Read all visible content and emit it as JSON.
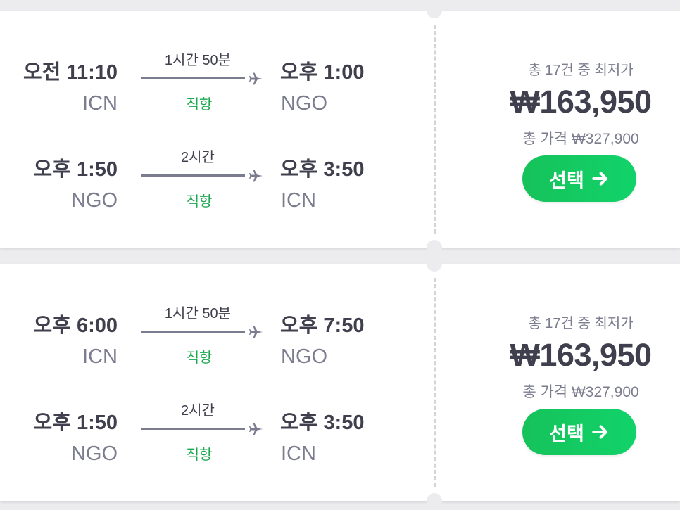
{
  "results": [
    {
      "legs": [
        {
          "departure_time": "오전 11:10",
          "departure_code": "ICN",
          "duration": "1시간 50분",
          "stops": "직항",
          "arrival_time": "오후 1:00",
          "arrival_code": "NGO"
        },
        {
          "departure_time": "오후 1:50",
          "departure_code": "NGO",
          "duration": "2시간",
          "stops": "직항",
          "arrival_time": "오후 3:50",
          "arrival_code": "ICN"
        }
      ],
      "price_caption": "총 17건 중 최저가",
      "price": "₩163,950",
      "total_price": "총 가격 ₩327,900",
      "select_label": "선택"
    },
    {
      "legs": [
        {
          "departure_time": "오후 6:00",
          "departure_code": "ICN",
          "duration": "1시간 50분",
          "stops": "직항",
          "arrival_time": "오후 7:50",
          "arrival_code": "NGO"
        },
        {
          "departure_time": "오후 1:50",
          "departure_code": "NGO",
          "duration": "2시간",
          "stops": "직항",
          "arrival_time": "오후 3:50",
          "arrival_code": "ICN"
        }
      ],
      "price_caption": "총 17건 중 최저가",
      "price": "₩163,950",
      "total_price": "총 가격 ₩327,900",
      "select_label": "선택"
    }
  ],
  "colors": {
    "text_dark": "#3f3f4d",
    "text_muted": "#7b7c8e",
    "direct_green": "#1aa84e",
    "button_green": "#16c25a",
    "background": "#ececef"
  },
  "icons": {
    "plane": "plane-icon",
    "arrow": "arrow-right-icon"
  }
}
